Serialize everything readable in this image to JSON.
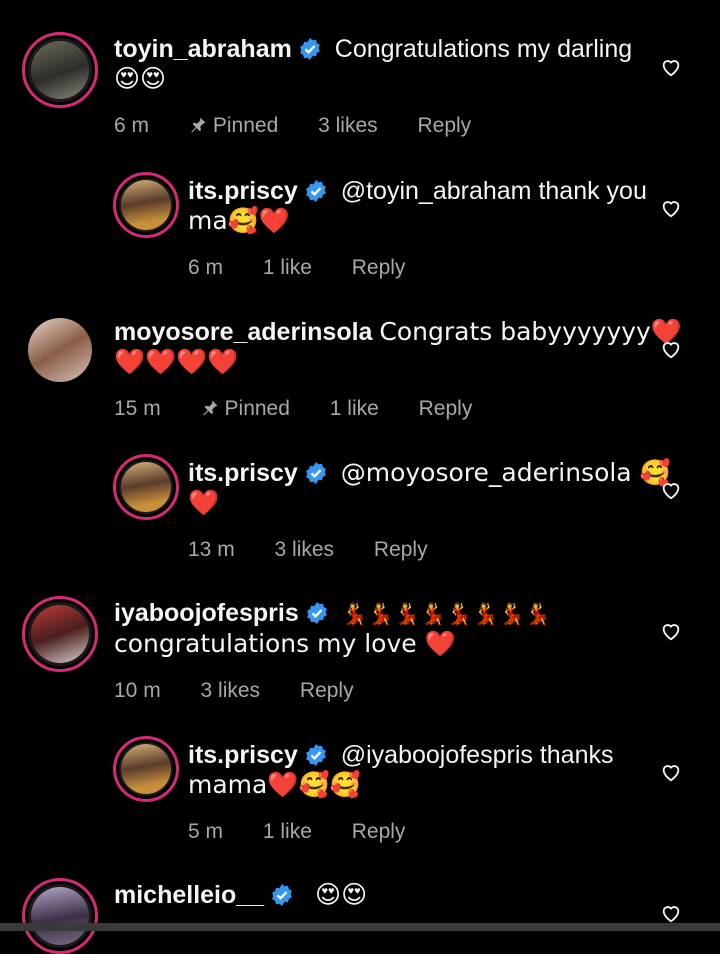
{
  "comments": [
    {
      "username": "toyin_abraham",
      "text_line1": "Congratulations my darling",
      "text_line2": "😍😍",
      "time": "6 m",
      "pinned": "Pinned",
      "likes": "3 likes",
      "reply": "Reply"
    },
    {
      "username": "its.priscy",
      "text_line1": "@toyin_abraham thank you",
      "text_line2": "ma🥰❤️",
      "time": "6 m",
      "likes": "1 like",
      "reply": "Reply"
    },
    {
      "username": "moyosore_aderinsola",
      "text_line1": "Congrats babyyyyyyy❤️",
      "text_line2": "❤️❤️❤️❤️",
      "time": "15 m",
      "pinned": "Pinned",
      "likes": "1 like",
      "reply": "Reply"
    },
    {
      "username": "its.priscy",
      "text_line1": "@moyosore_aderinsola 🥰",
      "text_line2": "❤️",
      "time": "13 m",
      "likes": "3 likes",
      "reply": "Reply"
    },
    {
      "username": "iyaboojofespris",
      "text_line1": "💃💃💃💃💃💃💃💃",
      "text_line2": "congratulations my love ❤️",
      "time": "10 m",
      "likes": "3 likes",
      "reply": "Reply"
    },
    {
      "username": "its.priscy",
      "text_line1": "@iyaboojofespris thanks",
      "text_line2": "mama❤️🥰🥰",
      "time": "5 m",
      "likes": "1 like",
      "reply": "Reply"
    },
    {
      "username": "michelleio__",
      "text_line1": "😍😍"
    }
  ],
  "colors": {
    "background": "#000000",
    "text": "#f5f5f5",
    "meta": "#a8a8a8",
    "verified": "#3797f0",
    "story_ring": "#d62976"
  },
  "icons": {
    "verified": "verified-badge-icon",
    "pin": "pin-icon",
    "like": "heart-outline-icon"
  }
}
